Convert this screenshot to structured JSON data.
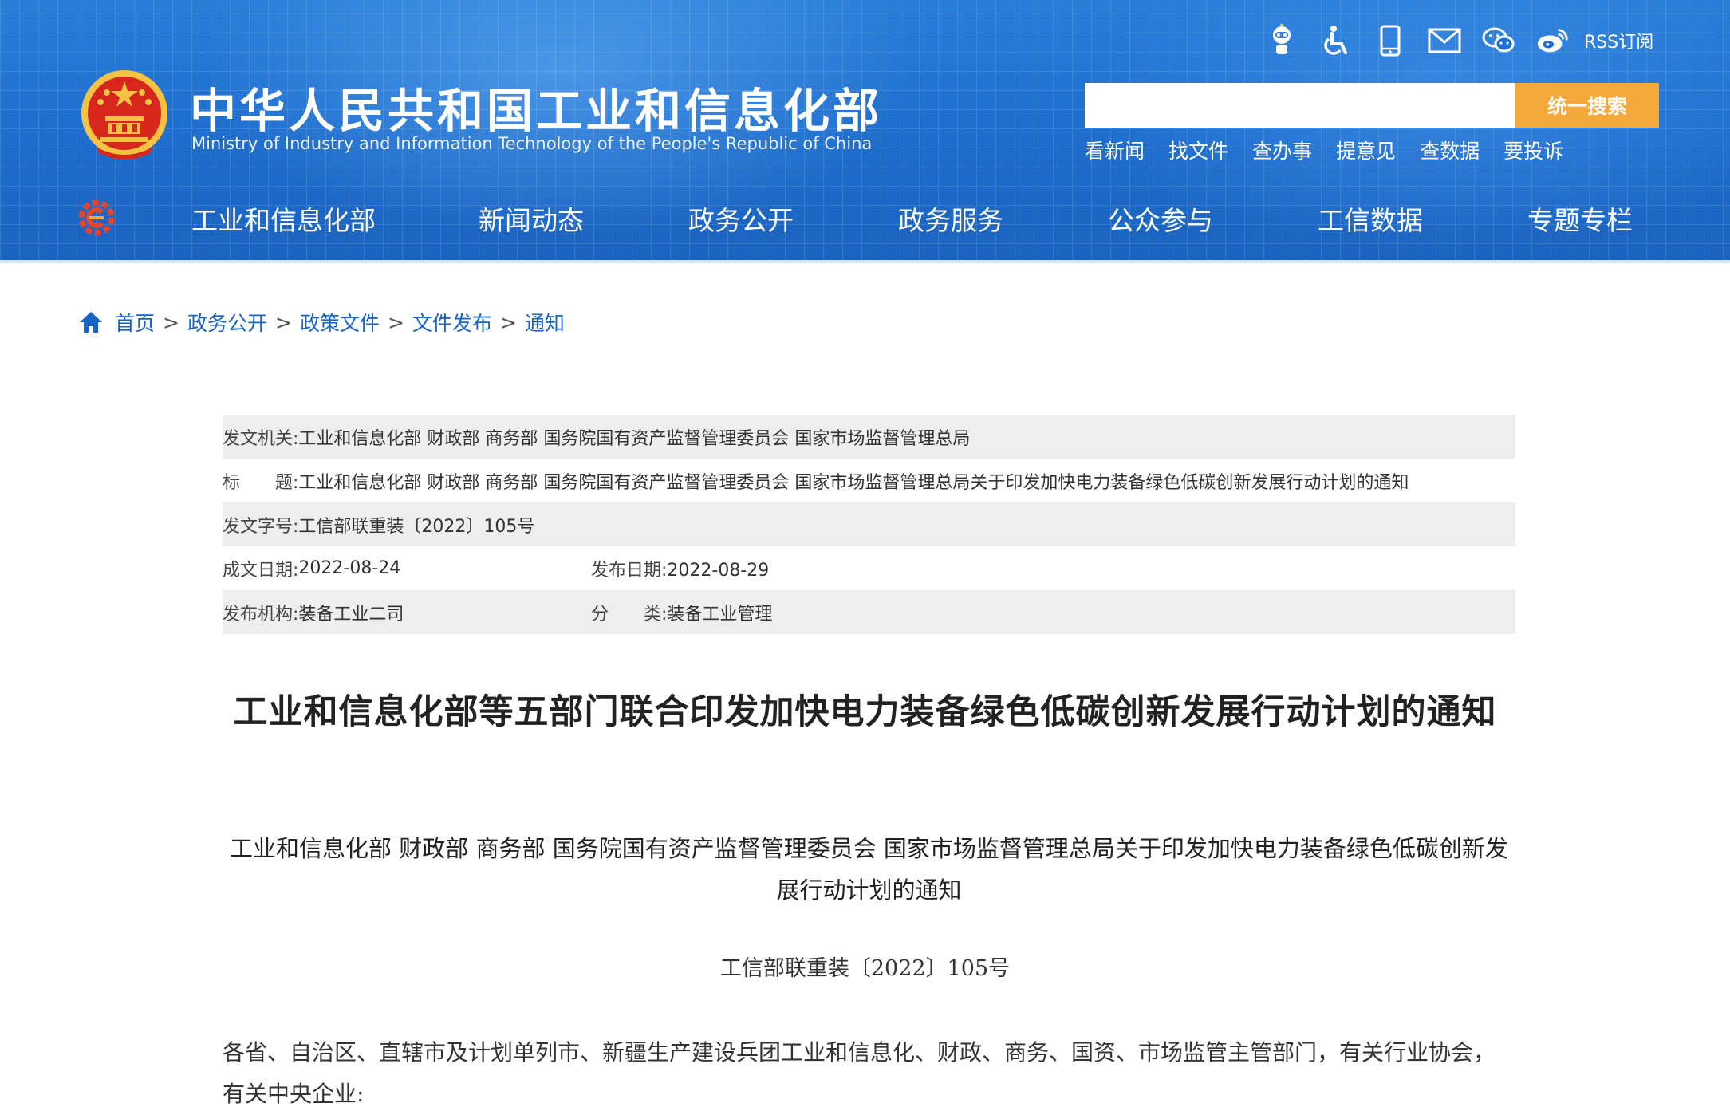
{
  "header": {
    "site_title": "中华人民共和国工业和信息化部",
    "site_subtitle": "Ministry of Industry and Information Technology of the People's Republic of China",
    "top_icons": [
      "robot-assistant-icon",
      "accessibility-icon",
      "mobile-icon",
      "mail-icon",
      "wechat-icon",
      "weibo-icon"
    ],
    "rss_label": "RSS订阅",
    "search": {
      "placeholder": "",
      "button_label": "统一搜索"
    },
    "quick_links": [
      "看新闻",
      "找文件",
      "查办事",
      "提意见",
      "查数据",
      "要投诉"
    ],
    "nav": [
      "工业和信息化部",
      "新闻动态",
      "政务公开",
      "政务服务",
      "公众参与",
      "工信数据",
      "专题专栏"
    ]
  },
  "breadcrumb": [
    "首页",
    "政务公开",
    "政策文件",
    "文件发布",
    "通知"
  ],
  "info": {
    "issuer_label": "发文机关:",
    "issuer": "工业和信息化部 财政部 商务部 国务院国有资产监督管理委员会 国家市场监督管理总局",
    "title_label": "标　　题:",
    "title": "工业和信息化部 财政部 商务部 国务院国有资产监督管理委员会 国家市场监督管理总局关于印发加快电力装备绿色低碳创新发展行动计划的通知",
    "doc_no_label": "发文字号:",
    "doc_no": "工信部联重装〔2022〕105号",
    "created_label": "成文日期:",
    "created": "2022-08-24",
    "published_label": "发布日期:",
    "published": "2022-08-29",
    "org_label": "发布机构:",
    "org": "装备工业二司",
    "category_label": "分　　类:",
    "category": "装备工业管理"
  },
  "article": {
    "main_title": "工业和信息化部等五部门联合印发加快电力装备绿色低碳创新发展行动计划的通知",
    "sub_title": "工业和信息化部 财政部 商务部 国务院国有资产监督管理委员会 国家市场监督管理总局关于印发加快电力装备绿色低碳创新发展行动计划的通知",
    "doc_no": "工信部联重装〔2022〕105号",
    "body_para": "各省、自治区、直辖市及计划单列市、新疆生产建设兵团工业和信息化、财政、商务、国资、市场监管主管部门，有关行业协会，有关中央企业:"
  },
  "colors": {
    "header_blue": "#1f6fcf",
    "search_button": "#f3a93a",
    "link_blue": "#1763c7",
    "row_shade": "#eeeeee"
  }
}
